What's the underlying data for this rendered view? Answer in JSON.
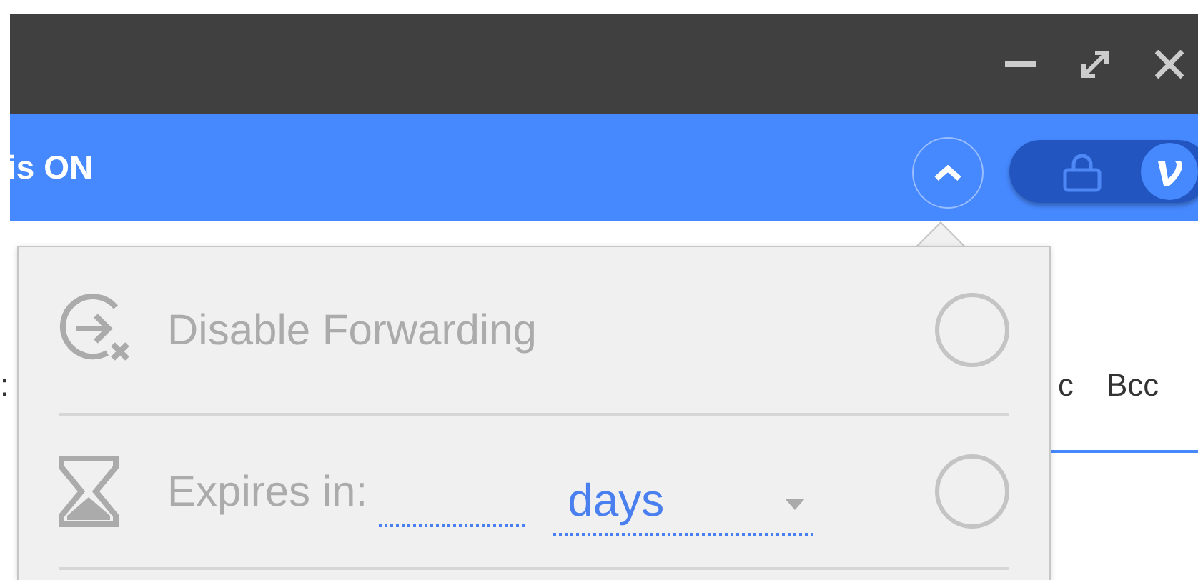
{
  "banner": {
    "text": "is ON",
    "collapse_button": {
      "expanded": true
    },
    "toggle": {
      "on": true
    }
  },
  "compose": {
    "cc_label": "c",
    "bcc_label": "Bcc",
    "fragment": ":"
  },
  "menu": {
    "items": [
      {
        "kind": "option",
        "label": "Disable Forwarding",
        "selected": false
      },
      {
        "kind": "expiry",
        "label": "Expires in:",
        "value": "",
        "unit": "days",
        "selected": false
      }
    ]
  }
}
